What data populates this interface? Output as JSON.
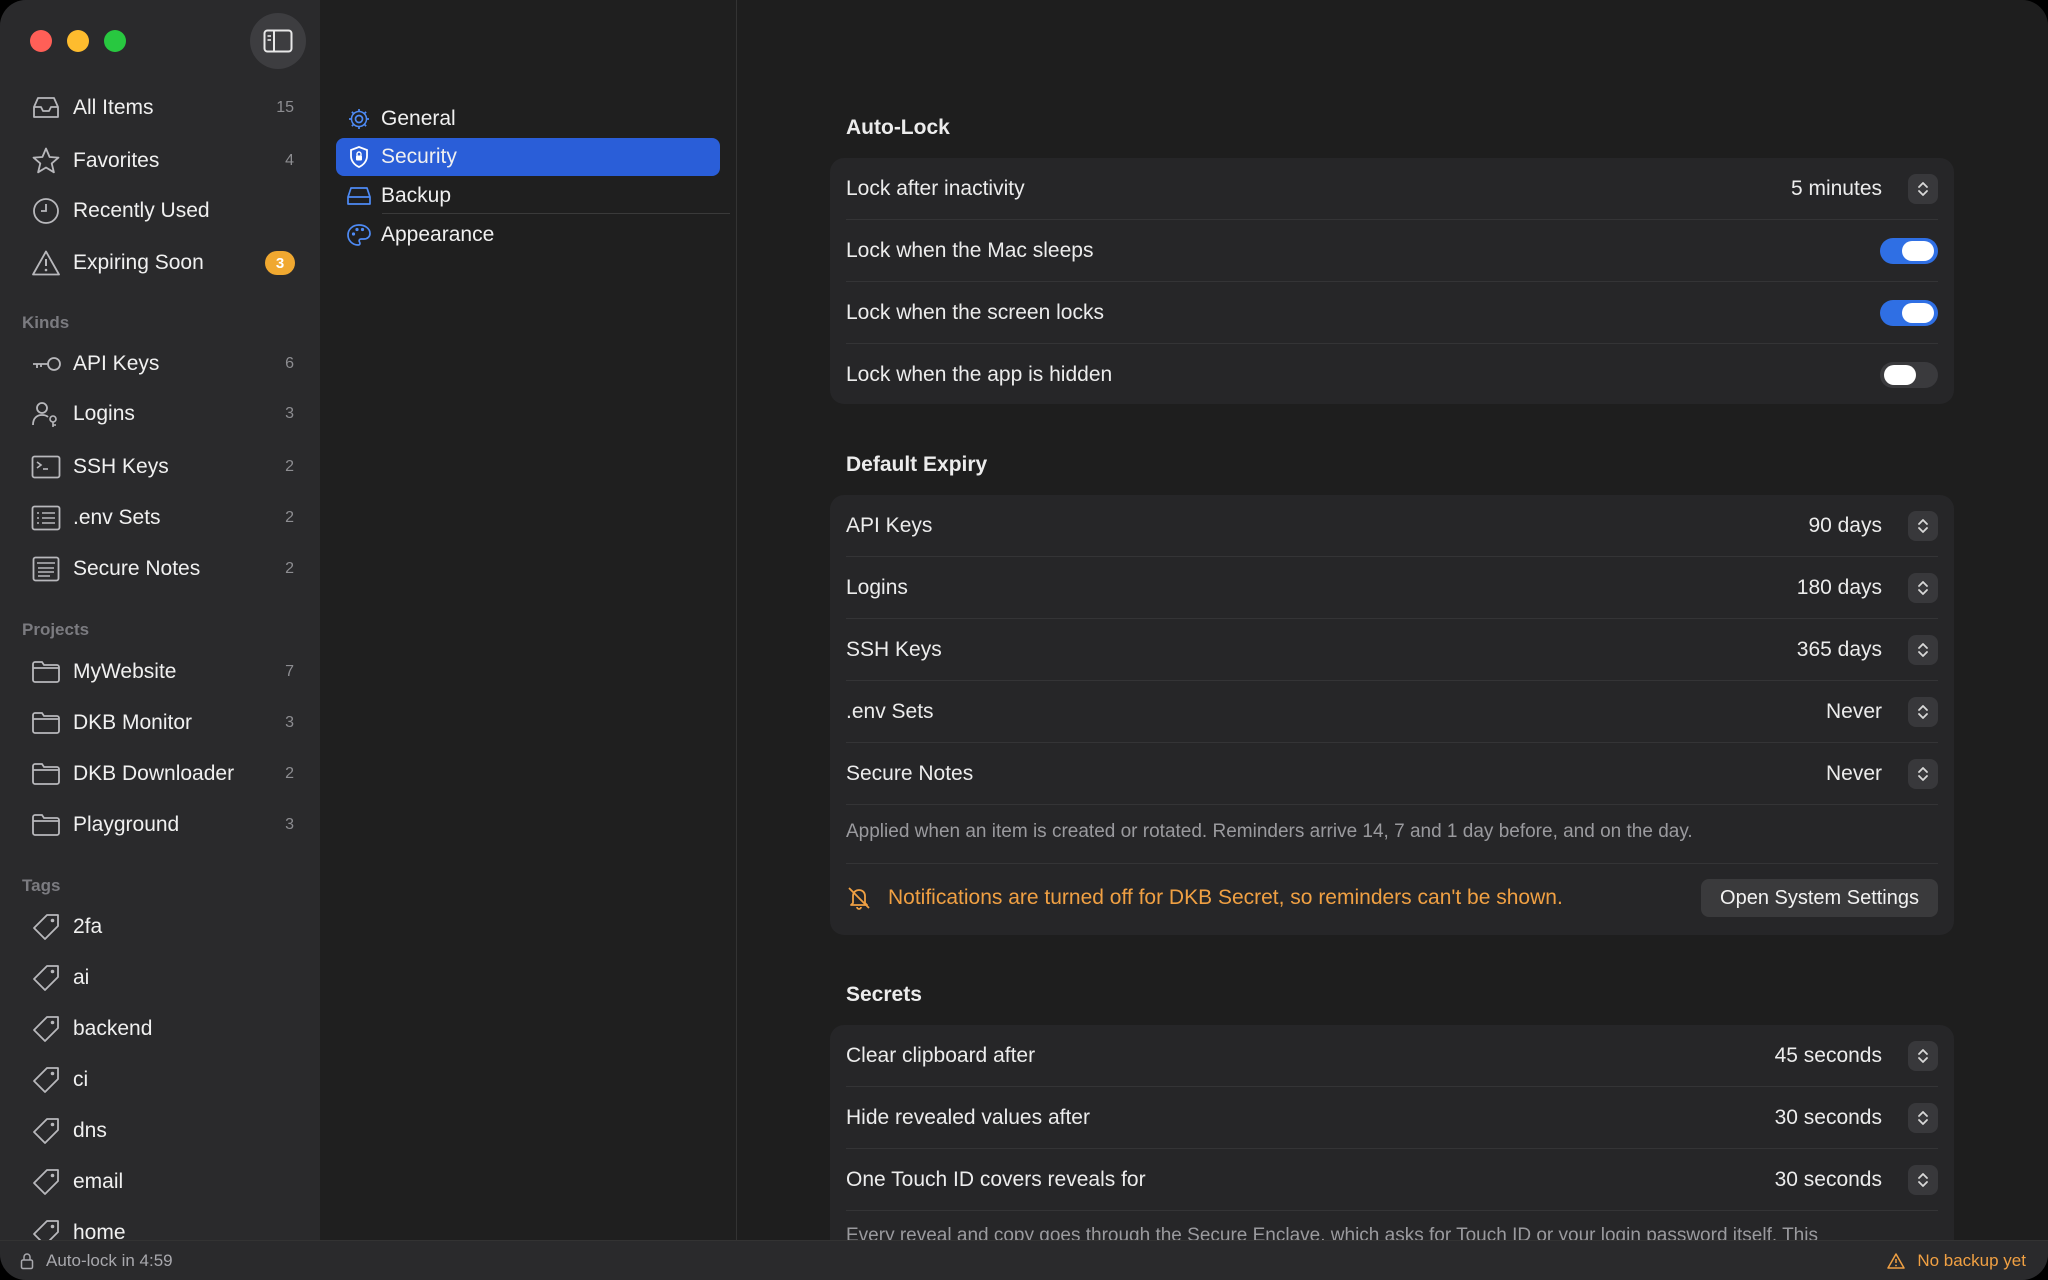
{
  "sidebar": {
    "items": [
      {
        "label": "All Items",
        "count": "15",
        "icon": "tray-icon"
      },
      {
        "label": "Favorites",
        "count": "4",
        "icon": "star-icon"
      },
      {
        "label": "Recently Used",
        "count": "",
        "icon": "clock-icon"
      },
      {
        "label": "Expiring Soon",
        "badge": "3",
        "icon": "warning-icon"
      }
    ],
    "kinds_heading": "Kinds",
    "kinds": [
      {
        "label": "API Keys",
        "count": "6",
        "icon": "key-icon"
      },
      {
        "label": "Logins",
        "count": "3",
        "icon": "person-key-icon"
      },
      {
        "label": "SSH Keys",
        "count": "2",
        "icon": "terminal-icon"
      },
      {
        "label": ".env Sets",
        "count": "2",
        "icon": "list-icon"
      },
      {
        "label": "Secure Notes",
        "count": "2",
        "icon": "note-icon"
      }
    ],
    "projects_heading": "Projects",
    "projects": [
      {
        "label": "MyWebsite",
        "count": "7",
        "icon": "folder-icon"
      },
      {
        "label": "DKB Monitor",
        "count": "3",
        "icon": "folder-icon"
      },
      {
        "label": "DKB Downloader",
        "count": "2",
        "icon": "folder-icon"
      },
      {
        "label": "Playground",
        "count": "3",
        "icon": "folder-icon"
      }
    ],
    "tags_heading": "Tags",
    "tags": [
      {
        "label": "2fa",
        "icon": "tag-icon"
      },
      {
        "label": "ai",
        "icon": "tag-icon"
      },
      {
        "label": "backend",
        "icon": "tag-icon"
      },
      {
        "label": "ci",
        "icon": "tag-icon"
      },
      {
        "label": "dns",
        "icon": "tag-icon"
      },
      {
        "label": "email",
        "icon": "tag-icon"
      },
      {
        "label": "home",
        "icon": "tag-icon"
      }
    ]
  },
  "settings_nav": {
    "items": [
      {
        "label": "General",
        "icon": "gear-icon"
      },
      {
        "label": "Security",
        "icon": "shield-icon",
        "active": true
      },
      {
        "label": "Backup",
        "icon": "drive-icon"
      },
      {
        "label": "Appearance",
        "icon": "palette-icon"
      }
    ]
  },
  "auto_lock": {
    "title": "Auto-Lock",
    "lock_after_label": "Lock after inactivity",
    "lock_after_value": "5 minutes",
    "mac_sleeps_label": "Lock when the Mac sleeps",
    "mac_sleeps_on": true,
    "screen_locks_label": "Lock when the screen locks",
    "screen_locks_on": true,
    "app_hidden_label": "Lock when the app is hidden",
    "app_hidden_on": false
  },
  "default_expiry": {
    "title": "Default Expiry",
    "rows": [
      {
        "label": "API Keys",
        "value": "90 days"
      },
      {
        "label": "Logins",
        "value": "180 days"
      },
      {
        "label": "SSH Keys",
        "value": "365 days"
      },
      {
        "label": ".env Sets",
        "value": "Never"
      },
      {
        "label": "Secure Notes",
        "value": "Never"
      }
    ],
    "footnote": "Applied when an item is created or rotated. Reminders arrive 14, 7 and 1 day before, and on the day.",
    "warning": "Notifications are turned off for DKB Secret, so reminders can't be shown.",
    "open_settings_label": "Open System Settings"
  },
  "secrets": {
    "title": "Secrets",
    "rows": [
      {
        "label": "Clear clipboard after",
        "value": "45 seconds"
      },
      {
        "label": "Hide revealed values after",
        "value": "30 seconds"
      },
      {
        "label": "One Touch ID covers reveals for",
        "value": "30 seconds"
      }
    ],
    "footnote": "Every reveal and copy goes through the Secure Enclave, which asks for Touch ID or your login password itself. This"
  },
  "status": {
    "left": "Auto-lock in 4:59",
    "right": "No backup yet"
  },
  "colors": {
    "accent": "#2a5ed8",
    "toggle_on": "#2f6fe4",
    "warning": "#f0a043",
    "badge": "#f0a830"
  }
}
